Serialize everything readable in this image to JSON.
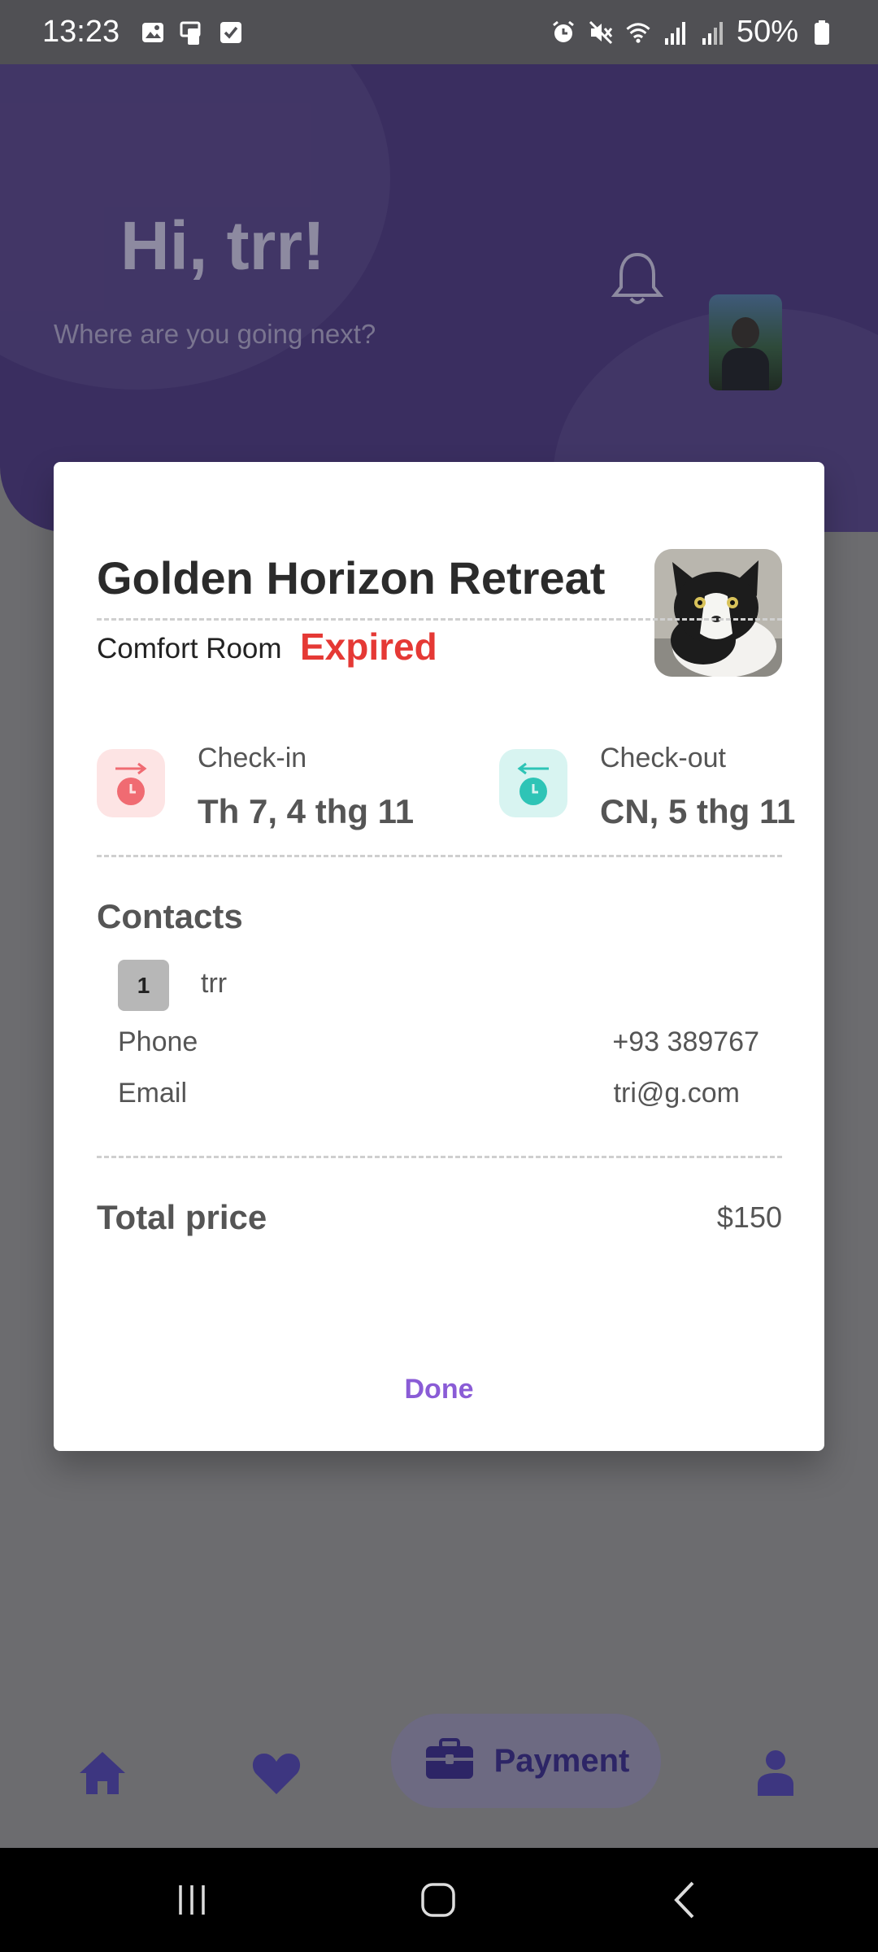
{
  "status_bar": {
    "time": "13:23",
    "battery": "50%",
    "left_icons": [
      "image-icon",
      "cast-icon",
      "checkbox-icon"
    ],
    "right_icons": [
      "alarm-icon",
      "mute-icon",
      "wifi-icon",
      "signal-icon",
      "signal-icon",
      "battery-icon"
    ]
  },
  "header": {
    "greeting": "Hi, trr!",
    "subtitle": "Where are you going next?"
  },
  "booking": {
    "hotel_name": "Golden Horizon Retreat",
    "room_type": "Comfort Room",
    "status": "Expired",
    "checkin_label": "Check-in",
    "checkin_date": "Th 7, 4 thg 11",
    "checkout_label": "Check-out",
    "checkout_date": "CN, 5 thg 11",
    "contacts_title": "Contacts",
    "contact_index": "1",
    "contact_name": "trr",
    "phone_label": "Phone",
    "phone_value": "+93 389767",
    "email_label": "Email",
    "email_value": "tri@g.com",
    "total_label": "Total price",
    "total_value": "$150",
    "done_label": "Done"
  },
  "nav": {
    "active_label": "Payment"
  },
  "colors": {
    "accent": "#8a5cd6",
    "expired": "#e53935",
    "checkin": "#f06b72",
    "checkout": "#2ec4b6",
    "header_purple": "#3a2e60"
  }
}
